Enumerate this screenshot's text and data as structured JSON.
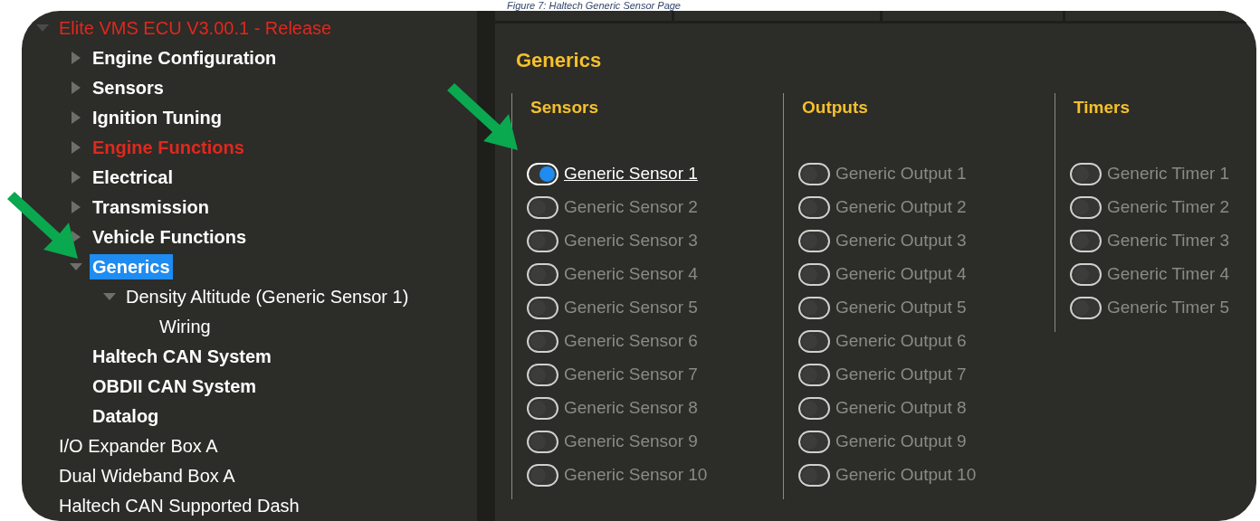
{
  "caption": "Figure 7: Haltech Generic Sensor Page",
  "tree": [
    {
      "label": "Elite VMS ECU V3.00.1 - Release",
      "error": true,
      "expanded": true,
      "selected": false,
      "children": [
        {
          "label": "Engine Configuration",
          "error": false,
          "expanded": false,
          "selected": false
        },
        {
          "label": "Sensors",
          "error": false,
          "expanded": false,
          "selected": false
        },
        {
          "label": "Ignition Tuning",
          "error": false,
          "expanded": false,
          "selected": false
        },
        {
          "label": "Engine Functions",
          "error": true,
          "expanded": false,
          "selected": false
        },
        {
          "label": "Electrical",
          "error": false,
          "expanded": false,
          "selected": false
        },
        {
          "label": "Transmission",
          "error": false,
          "expanded": false,
          "selected": false
        },
        {
          "label": "Vehicle Functions",
          "error": false,
          "expanded": false,
          "selected": false
        },
        {
          "label": "Generics",
          "error": false,
          "expanded": true,
          "selected": true,
          "children": [
            {
              "label": "Density Altitude (Generic Sensor 1)",
              "error": false,
              "expanded": true,
              "selected": false,
              "children": [
                {
                  "label": "Wiring",
                  "error": false,
                  "selected": false
                }
              ]
            }
          ]
        },
        {
          "label": "Haltech CAN System",
          "error": false,
          "selected": false
        },
        {
          "label": "OBDII CAN System",
          "error": false,
          "selected": false
        },
        {
          "label": "Datalog",
          "error": false,
          "selected": false
        }
      ]
    },
    {
      "label": "I/O Expander Box A",
      "error": false,
      "selected": false
    },
    {
      "label": "Dual Wideband Box A",
      "error": false,
      "selected": false
    },
    {
      "label": "Haltech CAN Supported Dash",
      "error": false,
      "selected": false
    }
  ],
  "page": {
    "title": "Generics",
    "groups": [
      {
        "heading": "Sensors",
        "items": [
          {
            "label": "Generic Sensor 1",
            "on": true
          },
          {
            "label": "Generic Sensor 2",
            "on": false
          },
          {
            "label": "Generic Sensor 3",
            "on": false
          },
          {
            "label": "Generic Sensor 4",
            "on": false
          },
          {
            "label": "Generic Sensor 5",
            "on": false
          },
          {
            "label": "Generic Sensor 6",
            "on": false
          },
          {
            "label": "Generic Sensor 7",
            "on": false
          },
          {
            "label": "Generic Sensor 8",
            "on": false
          },
          {
            "label": "Generic Sensor 9",
            "on": false
          },
          {
            "label": "Generic Sensor 10",
            "on": false
          }
        ]
      },
      {
        "heading": "Outputs",
        "items": [
          {
            "label": "Generic Output 1",
            "on": false
          },
          {
            "label": "Generic Output 2",
            "on": false
          },
          {
            "label": "Generic Output 3",
            "on": false
          },
          {
            "label": "Generic Output 4",
            "on": false
          },
          {
            "label": "Generic Output 5",
            "on": false
          },
          {
            "label": "Generic Output 6",
            "on": false
          },
          {
            "label": "Generic Output 7",
            "on": false
          },
          {
            "label": "Generic Output 8",
            "on": false
          },
          {
            "label": "Generic Output 9",
            "on": false
          },
          {
            "label": "Generic Output 10",
            "on": false
          }
        ]
      },
      {
        "heading": "Timers",
        "items": [
          {
            "label": "Generic Timer 1",
            "on": false
          },
          {
            "label": "Generic Timer 2",
            "on": false
          },
          {
            "label": "Generic Timer 3",
            "on": false
          },
          {
            "label": "Generic Timer 4",
            "on": false
          },
          {
            "label": "Generic Timer 5",
            "on": false
          }
        ]
      }
    ]
  }
}
